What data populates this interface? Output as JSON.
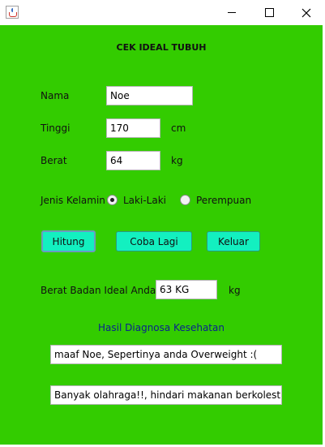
{
  "window": {
    "icon": "java-cup-icon",
    "controls": [
      "minimize-icon",
      "maximize-icon",
      "close-icon"
    ]
  },
  "colors": {
    "background": "#33cc00",
    "button": "#13f0c0",
    "heading_text": "#0a1f8f"
  },
  "form": {
    "title": "CEK IDEAL TUBUH",
    "nama": {
      "label": "Nama",
      "value": "Noe"
    },
    "tinggi": {
      "label": "Tinggi",
      "value": "170",
      "unit": "cm"
    },
    "berat": {
      "label": "Berat",
      "value": "64",
      "unit": "kg"
    },
    "gender": {
      "label": "Jenis Kelamin",
      "options": [
        {
          "label": "Laki-Laki",
          "selected": true
        },
        {
          "label": "Perempuan",
          "selected": false
        }
      ]
    }
  },
  "buttons": {
    "hitung": "Hitung",
    "coba_lagi": "Coba Lagi",
    "keluar": "Keluar"
  },
  "result": {
    "ideal_label": "Berat Badan Ideal Anda :",
    "ideal_value": "63 KG",
    "ideal_unit": "kg",
    "diagnosis_heading": "Hasil Diagnosa Kesehatan",
    "diagnosis_text": "maaf Noe, Sepertinya anda Overweight :(",
    "advice_text": "Banyak olahraga!!, hindari makanan berkolestrol"
  }
}
